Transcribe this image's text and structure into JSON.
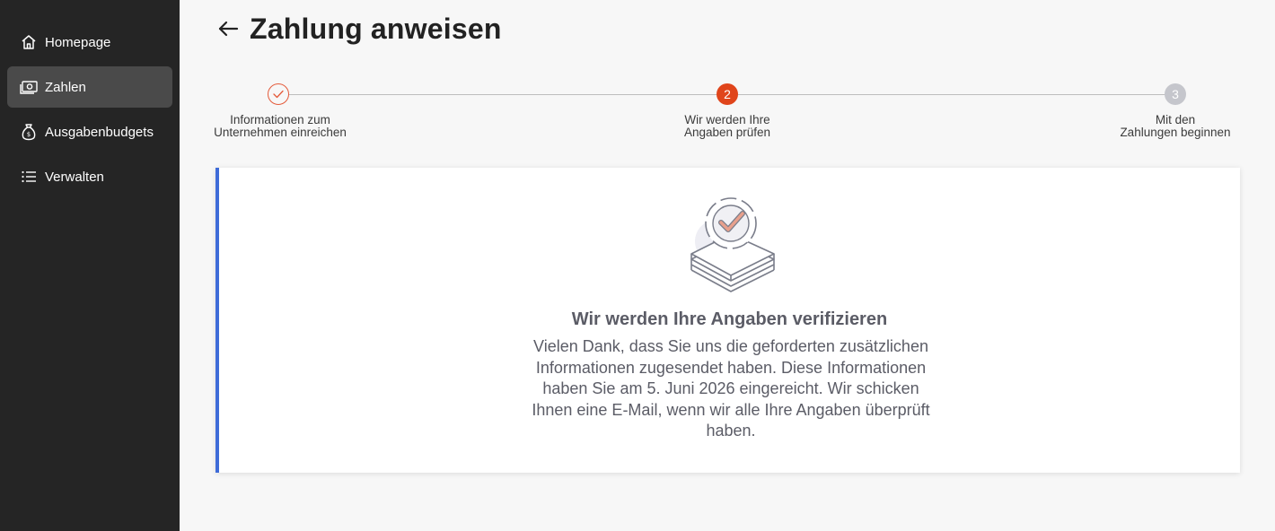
{
  "sidebar": {
    "items": [
      {
        "label": "Homepage",
        "icon": "home-icon",
        "active": false
      },
      {
        "label": "Zahlen",
        "icon": "money-icon",
        "active": true
      },
      {
        "label": "Ausgabenbudgets",
        "icon": "money-bag-icon",
        "active": false
      },
      {
        "label": "Verwalten",
        "icon": "list-icon",
        "active": false
      }
    ]
  },
  "header": {
    "title": "Zahlung anweisen",
    "back_icon": "arrow-left-icon"
  },
  "stepper": {
    "steps": [
      {
        "number": "1",
        "label_line1": "Informationen zum",
        "label_line2": "Unternehmen einreichen",
        "status": "completed"
      },
      {
        "number": "2",
        "label_line1": "Wir werden Ihre",
        "label_line2": "Angaben prüfen",
        "status": "current"
      },
      {
        "number": "3",
        "label_line1": "Mit den",
        "label_line2": "Zahlungen beginnen",
        "status": "upcoming"
      }
    ]
  },
  "card": {
    "illustration": "verified-documents-icon",
    "heading": "Wir werden Ihre Angaben verifizieren",
    "body": "Vielen Dank, dass Sie uns die geforderten zusätzlichen Informationen zugesendet haben. Diese Informationen haben Sie am 5. Juni 2026 eingereicht. Wir schicken Ihnen eine E-Mail, wenn wir alle Ihre Angaben überprüft haben."
  },
  "colors": {
    "sidebar_bg": "#252525",
    "sidebar_active": "#4a4a4a",
    "accent_orange": "#e0451b",
    "accent_blue": "#3e6bd8",
    "step_upcoming": "#c5c6cc"
  }
}
